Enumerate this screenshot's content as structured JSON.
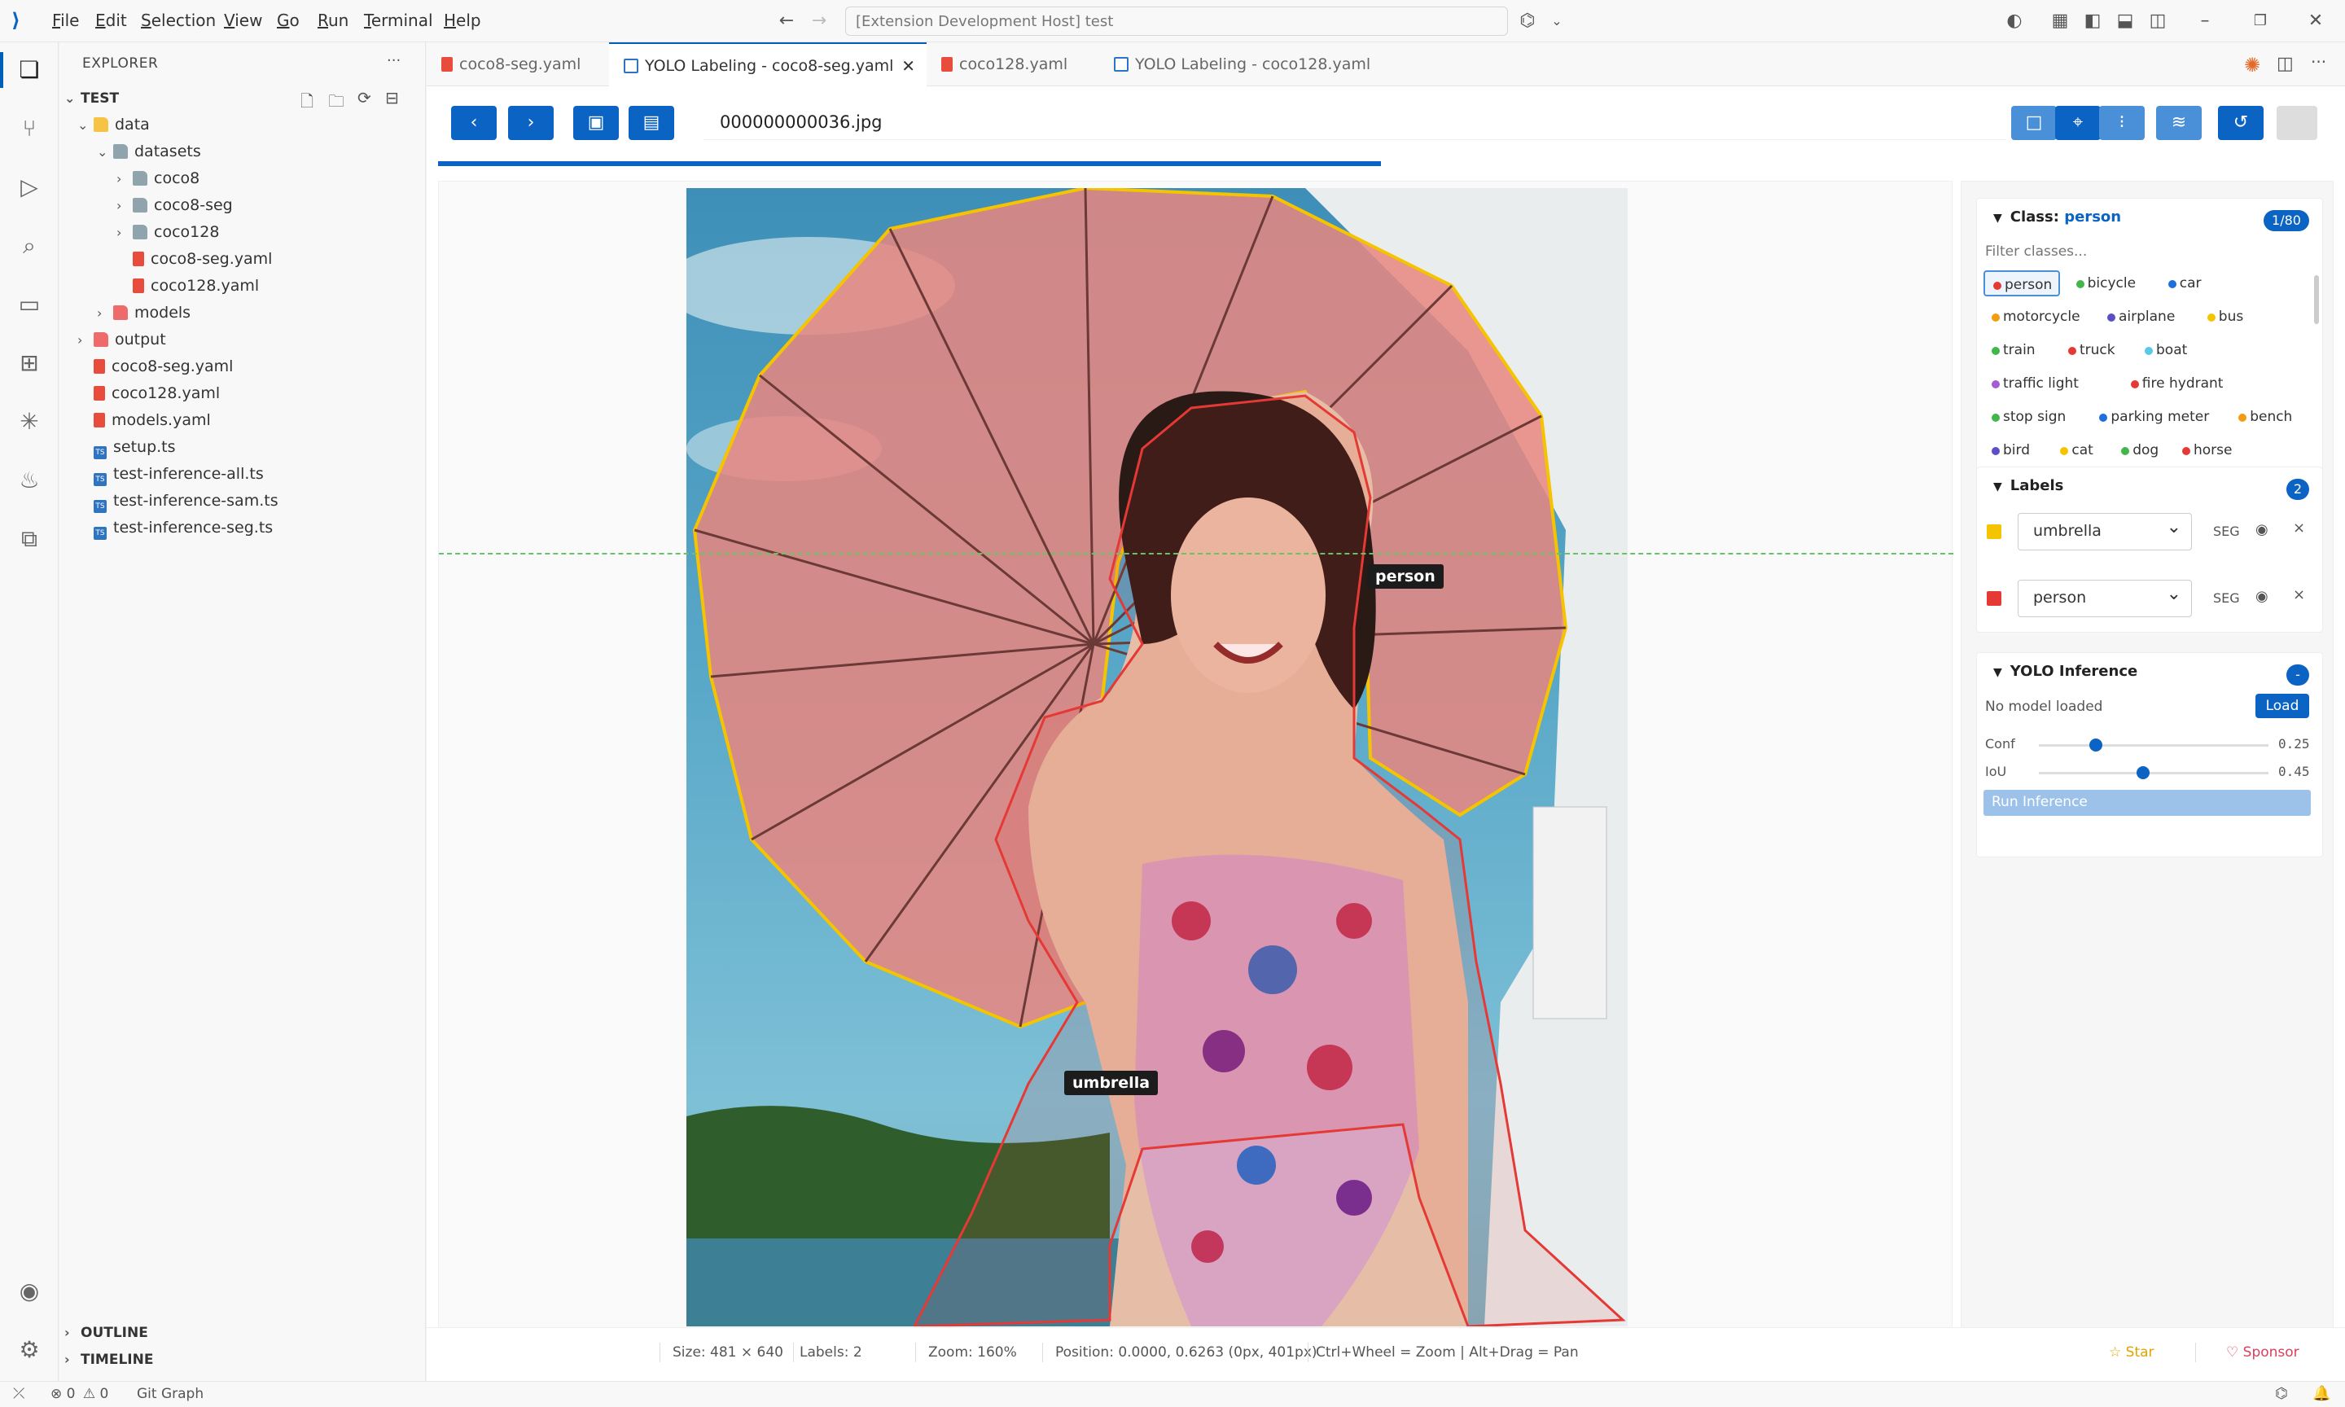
{
  "titlebar": {
    "menus": [
      "File",
      "Edit",
      "Selection",
      "View",
      "Go",
      "Run",
      "Terminal",
      "Help"
    ],
    "command_center": "[Extension Development Host] test"
  },
  "sidebar": {
    "title": "EXPLORER",
    "more": "···",
    "root": "TEST",
    "tree": [
      {
        "label": "data",
        "depth": 1,
        "kind": "folder-open",
        "chev": "⌄"
      },
      {
        "label": "datasets",
        "depth": 2,
        "kind": "folder-open-grey",
        "chev": "⌄"
      },
      {
        "label": "coco8",
        "depth": 3,
        "kind": "folder",
        "chev": "›"
      },
      {
        "label": "coco8-seg",
        "depth": 3,
        "kind": "folder",
        "chev": "›"
      },
      {
        "label": "coco128",
        "depth": 3,
        "kind": "folder",
        "chev": "›"
      },
      {
        "label": "coco8-seg.yaml",
        "depth": 3,
        "kind": "yaml",
        "chev": ""
      },
      {
        "label": "coco128.yaml",
        "depth": 3,
        "kind": "yaml",
        "chev": ""
      },
      {
        "label": "models",
        "depth": 2,
        "kind": "folder-red",
        "chev": "›"
      },
      {
        "label": "output",
        "depth": 1,
        "kind": "folder-red",
        "chev": "›"
      },
      {
        "label": "coco8-seg.yaml",
        "depth": 1,
        "kind": "yaml",
        "chev": ""
      },
      {
        "label": "coco128.yaml",
        "depth": 1,
        "kind": "yaml",
        "chev": ""
      },
      {
        "label": "models.yaml",
        "depth": 1,
        "kind": "yaml",
        "chev": ""
      },
      {
        "label": "setup.ts",
        "depth": 1,
        "kind": "ts",
        "chev": ""
      },
      {
        "label": "test-inference-all.ts",
        "depth": 1,
        "kind": "ts",
        "chev": ""
      },
      {
        "label": "test-inference-sam.ts",
        "depth": 1,
        "kind": "ts",
        "chev": ""
      },
      {
        "label": "test-inference-seg.ts",
        "depth": 1,
        "kind": "ts",
        "chev": ""
      }
    ],
    "outline": "OUTLINE",
    "timeline": "TIMELINE"
  },
  "tabs": [
    {
      "label": "coco8-seg.yaml",
      "active": false,
      "icon": "yaml"
    },
    {
      "label": "YOLO Labeling - coco8-seg.yaml",
      "active": true,
      "icon": "preview"
    },
    {
      "label": "coco128.yaml",
      "active": false,
      "icon": "yaml"
    },
    {
      "label": "YOLO Labeling - coco128.yaml",
      "active": false,
      "icon": "preview"
    }
  ],
  "toolbar": {
    "filename": "000000000036.jpg"
  },
  "progress_fraction": 0.5,
  "annotations": [
    {
      "label": "person",
      "color": "#e53935"
    },
    {
      "label": "umbrella",
      "color": "#f5c400"
    }
  ],
  "classes": {
    "header_prefix": "Class:",
    "current": "person",
    "count": "1/80",
    "filter_placeholder": "Filter classes...",
    "items": [
      {
        "name": "person",
        "color": "#e53935"
      },
      {
        "name": "bicycle",
        "color": "#43b649"
      },
      {
        "name": "car",
        "color": "#1e6fd9"
      },
      {
        "name": "motorcycle",
        "color": "#f39c12"
      },
      {
        "name": "airplane",
        "color": "#5b4fc7"
      },
      {
        "name": "bus",
        "color": "#f5c400"
      },
      {
        "name": "train",
        "color": "#43b649"
      },
      {
        "name": "truck",
        "color": "#e53935"
      },
      {
        "name": "boat",
        "color": "#5ac8e6"
      },
      {
        "name": "traffic light",
        "color": "#a55bd6"
      },
      {
        "name": "fire hydrant",
        "color": "#e53935"
      },
      {
        "name": "stop sign",
        "color": "#43b649"
      },
      {
        "name": "parking meter",
        "color": "#1e6fd9"
      },
      {
        "name": "bench",
        "color": "#f39c12"
      },
      {
        "name": "bird",
        "color": "#5b4fc7"
      },
      {
        "name": "cat",
        "color": "#f5c400"
      },
      {
        "name": "dog",
        "color": "#43b649"
      },
      {
        "name": "horse",
        "color": "#e53935"
      }
    ]
  },
  "labels": {
    "title": "Labels",
    "count": "2",
    "items": [
      {
        "name": "umbrella",
        "color": "#f5c400",
        "type": "SEG"
      },
      {
        "name": "person",
        "color": "#e53935",
        "type": "SEG"
      }
    ]
  },
  "inference": {
    "title": "YOLO Inference",
    "status": "No model loaded",
    "load_label": "Load",
    "conf_label": "Conf",
    "conf_value": "0.25",
    "iou_label": "IoU",
    "iou_value": "0.45",
    "run_label": "Run Inference",
    "badge": "-"
  },
  "status": {
    "size": "Size: 481 × 640",
    "labels": "Labels: 2",
    "zoom": "Zoom: 160%",
    "position": "Position: 0.0000, 0.6263 (0px, 401px)",
    "hint": "Ctrl+Wheel = Zoom | Alt+Drag = Pan",
    "star": "Star",
    "sponsor": "Sponsor"
  },
  "bottombar": {
    "errors": "0",
    "warnings": "0",
    "git": "Git Graph"
  }
}
